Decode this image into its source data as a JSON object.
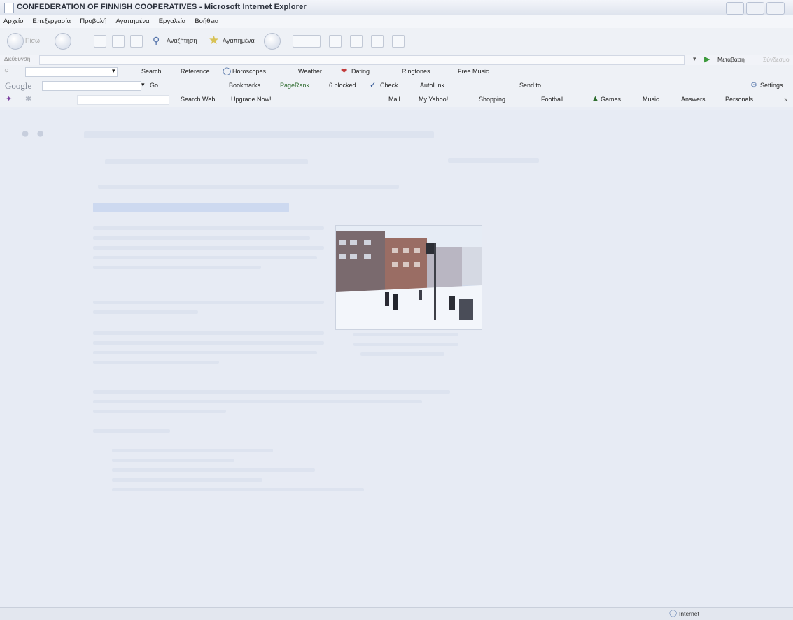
{
  "window": {
    "title": "CONFEDERATION OF FINNISH COOPERATIVES - Microsoft Internet Explorer"
  },
  "menubar": [
    "Αρχείο",
    "Επεξεργασία",
    "Προβολή",
    "Αγαπημένα",
    "Εργαλεία",
    "Βοήθεια"
  ],
  "navbar": {
    "back_label": "Πίσω",
    "search_label": "Αναζήτηση",
    "favorites_label": "Αγαπημένα"
  },
  "addressbar": {
    "label": "Διεύθυνση",
    "go_label": "Μετάβαση",
    "links_label": "Σύνδεσμοι"
  },
  "toolbar1": {
    "items": [
      "Search",
      "Reference",
      "Horoscopes",
      "Weather",
      "Dating",
      "Ringtones",
      "Free Music"
    ]
  },
  "google_toolbar": {
    "logo": "Google",
    "go_label": "Go",
    "items": [
      "Bookmarks",
      "PageRank",
      "6 blocked",
      "Check",
      "AutoLink",
      "Send to"
    ],
    "settings_label": "Settings"
  },
  "yahoo_toolbar": {
    "search_web_label": "Search Web",
    "upgrade_label": "Upgrade Now!",
    "items": [
      "Mail",
      "My Yahoo!",
      "Shopping",
      "Football",
      "Games",
      "Music",
      "Answers",
      "Personals"
    ],
    "more_label": "»"
  },
  "status": {
    "zone": "Internet"
  },
  "colors": {
    "page_bg": "#e7ebf4",
    "toolbar_bg": "#eef1f6",
    "heading_faint": "#cdd9f0"
  }
}
